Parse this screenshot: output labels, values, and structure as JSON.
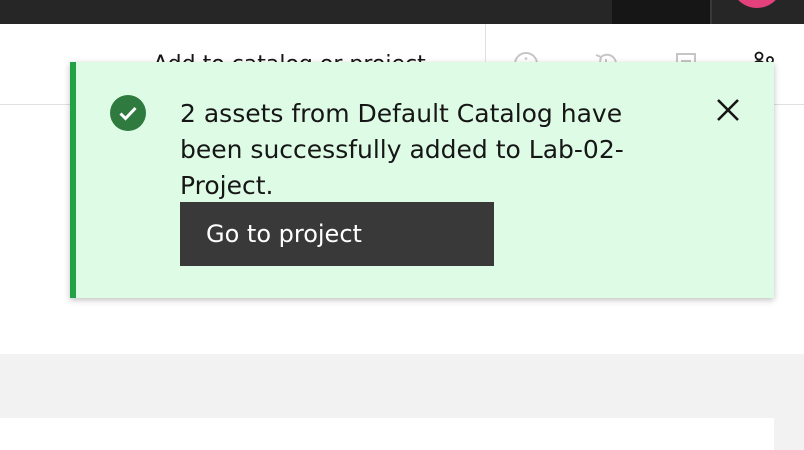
{
  "toolbar": {
    "title": "Add to catalog or project",
    "icons": [
      "info-icon",
      "history-icon",
      "notes-icon",
      "collaborators-icon"
    ]
  },
  "topbar": {
    "avatar_color": "#e2417c"
  },
  "notification": {
    "type": "success",
    "message": "2 assets from Default Catalog have been successfully added to Lab-02-Project.",
    "action_label": "Go to project",
    "icon": "checkmark-filled-icon",
    "close_icon": "close-icon",
    "accent_color": "#24a148",
    "background_color": "#defbe6"
  }
}
